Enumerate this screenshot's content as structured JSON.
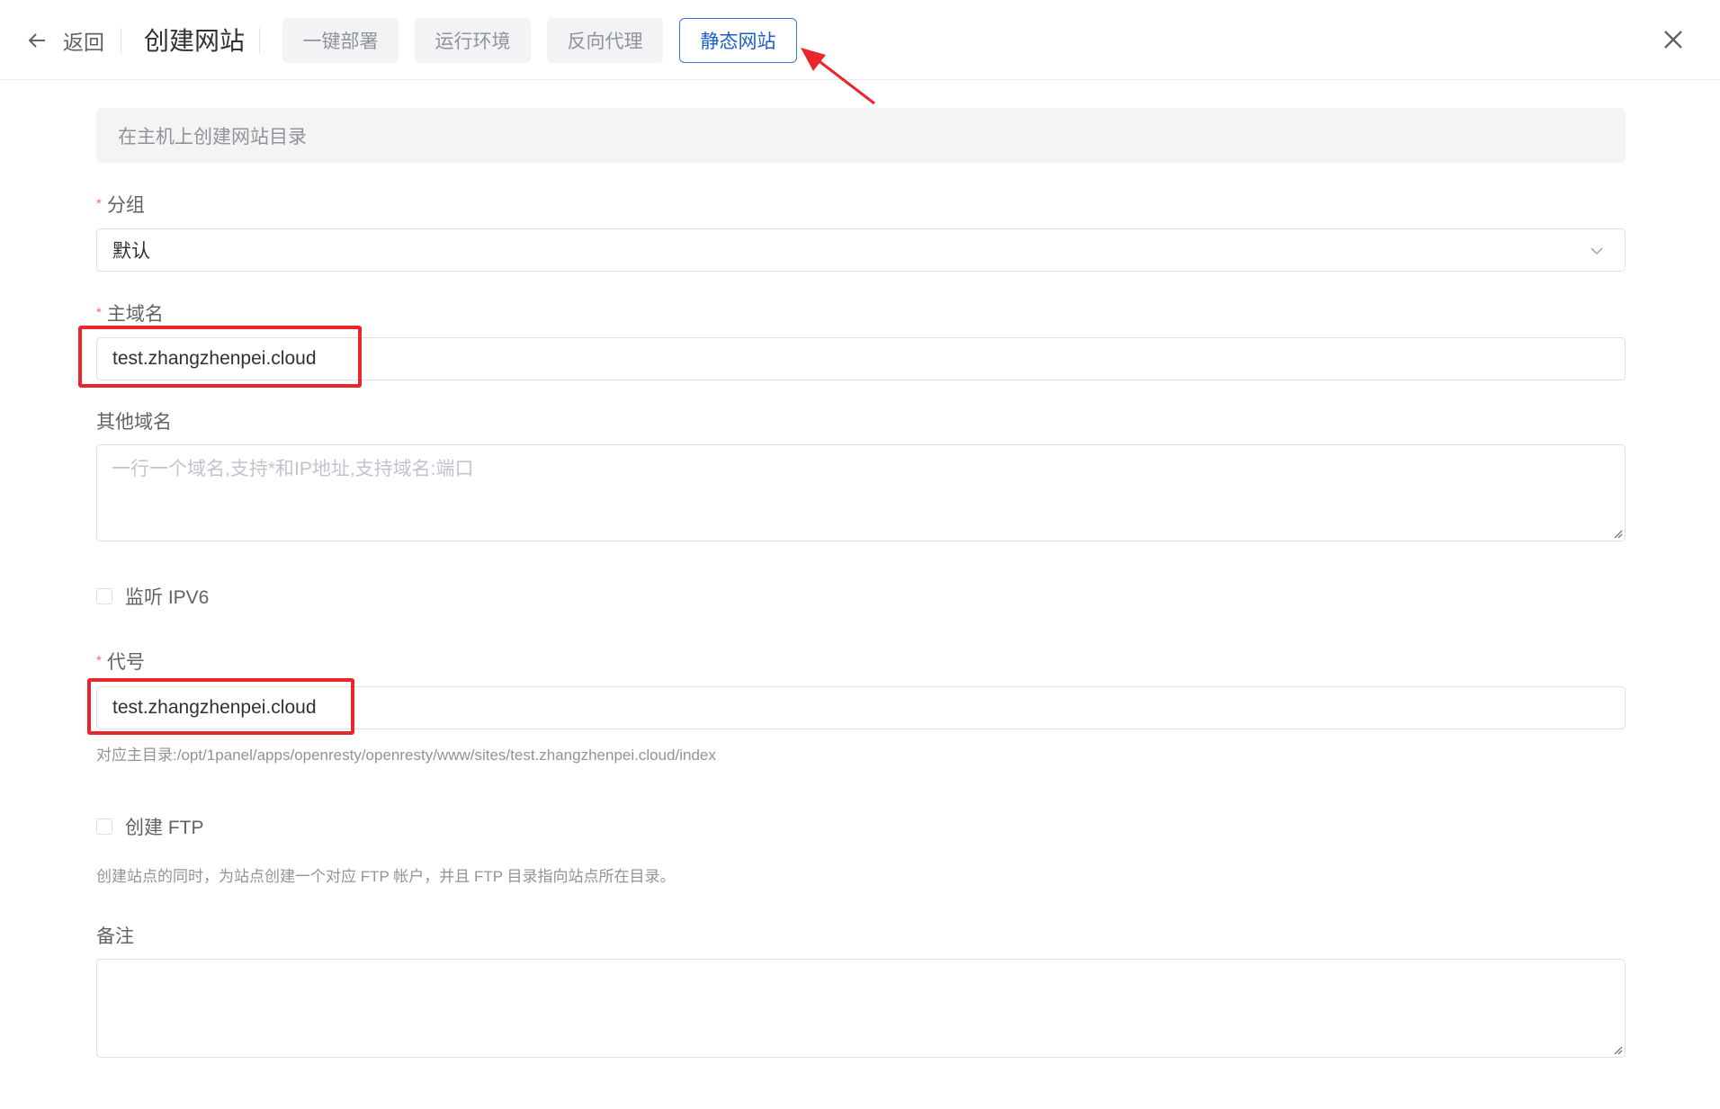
{
  "header": {
    "back_label": "返回",
    "title": "创建网站",
    "tabs": [
      {
        "label": "一键部署",
        "active": false
      },
      {
        "label": "运行环境",
        "active": false
      },
      {
        "label": "反向代理",
        "active": false
      },
      {
        "label": "静态网站",
        "active": true
      }
    ]
  },
  "form": {
    "alert": "在主机上创建网站目录",
    "group": {
      "label": "分组",
      "value": "默认",
      "required": true
    },
    "primary_domain": {
      "label": "主域名",
      "value": "test.zhangzhenpei.cloud",
      "required": true
    },
    "other_domains": {
      "label": "其他域名",
      "placeholder": "一行一个域名,支持*和IP地址,支持域名:端口"
    },
    "ipv6": {
      "label": "监听 IPV6",
      "checked": false
    },
    "alias": {
      "label": "代号",
      "value": "test.zhangzhenpei.cloud",
      "required": true,
      "help": "对应主目录:/opt/1panel/apps/openresty/openresty/www/sites/test.zhangzhenpei.cloud/index"
    },
    "ftp": {
      "label": "创建 FTP",
      "checked": false,
      "help": "创建站点的同时，为站点创建一个对应 FTP 帐户，并且 FTP 目录指向站点所在目录。"
    },
    "remark": {
      "label": "备注",
      "value": ""
    }
  },
  "colors": {
    "accent": "#1d5fc9",
    "highlight": "#e8262b",
    "required": "#f56c6c"
  }
}
